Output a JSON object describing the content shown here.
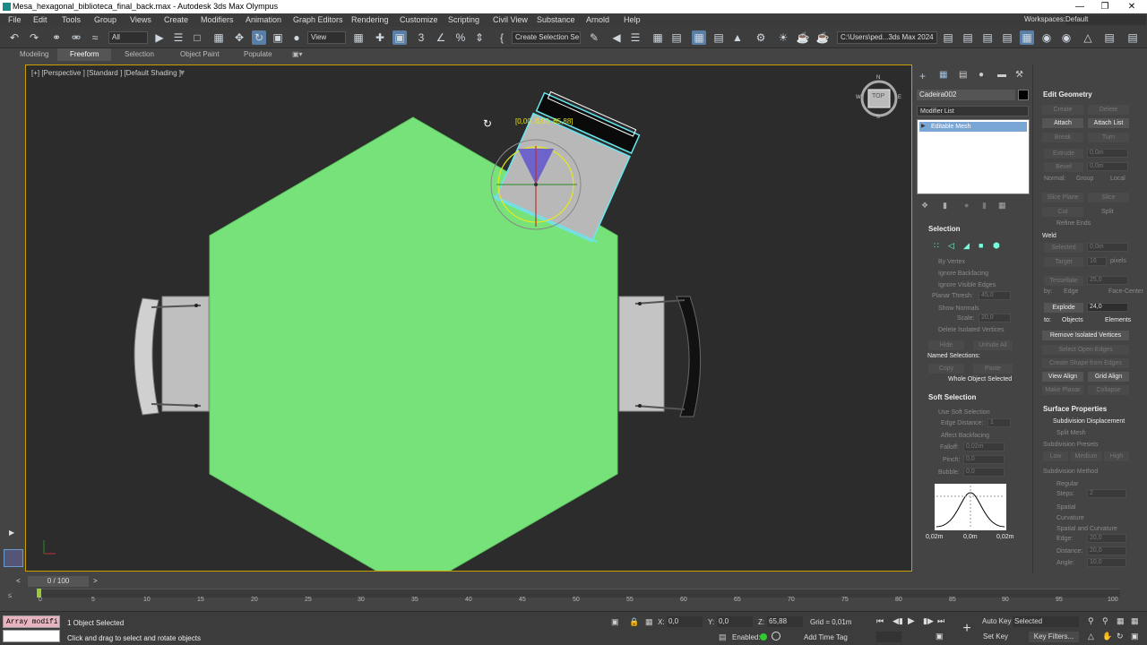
{
  "window": {
    "title": "Mesa_hexagonal_biblioteca_final_back.max - Autodesk 3ds Max Olympus"
  },
  "menu": [
    "File",
    "Edit",
    "Tools",
    "Group",
    "Views",
    "Create",
    "Modifiers",
    "Animation",
    "Graph Editors",
    "Rendering",
    "Customize",
    "Scripting",
    "Civil View",
    "Substance",
    "Arnold",
    "Help"
  ],
  "workspace": {
    "label": "Workspaces:",
    "value": "Default"
  },
  "toolbar": {
    "filter": "All",
    "coord": "View",
    "selset": "Create Selection Se",
    "path": "C:\\Users\\ped...3ds Max 2024"
  },
  "ribbon": {
    "tabs": [
      "Modeling",
      "Freeform",
      "Selection",
      "Object Paint",
      "Populate"
    ],
    "active": "Freeform"
  },
  "viewport": {
    "label": "[+] [Perspective ] [Standard ] [Default Shading ]",
    "gizmo_readout": "[0,00, 0,00, 65,88]",
    "viewcube": "TOP",
    "compass": {
      "n": "N",
      "s": "S",
      "e": "E",
      "w": "W"
    },
    "colors": {
      "table": "#77e27a",
      "selection": "#66e8f0",
      "bg": "#2c2c2c"
    }
  },
  "modify": {
    "object_name": "Cadeira002",
    "modifier_list": "Modifier List",
    "stack_item": "Editable Mesh"
  },
  "selection_rollout": {
    "title": "Selection",
    "by_vertex": "By Vertex",
    "ignore_backfacing": "Ignore Backfacing",
    "ignore_visible_edges": "Ignore Visible Edges",
    "planar_thresh": "Planar Thresh:",
    "planar_val": "45,0",
    "show_normals": "Show Normals",
    "scale": "Scale:",
    "scale_val": "20,0",
    "delete_isolated": "Delete Isolated Vertices",
    "hide": "Hide",
    "unhide_all": "Unhide All",
    "named_selections": "Named Selections:",
    "copy": "Copy",
    "paste": "Paste",
    "status": "Whole Object Selected"
  },
  "soft_selection": {
    "title": "Soft Selection",
    "use_soft": "Use Soft Selection",
    "edge_distance": "Edge Distance:",
    "edge_val": "1",
    "affect_backfacing": "Affect Backfacing",
    "falloff": "Falloff:",
    "falloff_val": "0,02m",
    "pinch": "Pinch:",
    "pinch_val": "0,0",
    "bubble": "Bubble:",
    "bubble_val": "0,0",
    "curve_labels": [
      "0,02m",
      "0,0m",
      "0,02m"
    ]
  },
  "edit_geometry": {
    "title": "Edit Geometry",
    "create": "Create",
    "delete": "Delete",
    "attach": "Attach",
    "attach_list": "Attach List",
    "break": "Break",
    "turn": "Turn",
    "extrude": "Extrude",
    "extrude_val": "0,0m",
    "bevel": "Bevel",
    "bevel_val": "0,0m",
    "normal": "Normal:",
    "group": "Group",
    "local": "Local",
    "slice_plane": "Slice Plane",
    "slice": "Slice",
    "cut": "Cut",
    "split": "Split",
    "refine_ends": "Refine Ends",
    "weld": "Weld",
    "selected": "Selected",
    "selected_val": "0,0m",
    "target": "Target",
    "target_val": "16",
    "pixels": "pixels",
    "tessellate": "Tessellate",
    "tess_val": "25,0",
    "by": "by:",
    "edge": "Edge",
    "face_center": "Face-Center",
    "explode": "Explode",
    "explode_val": "24,0",
    "to": "to:",
    "objects": "Objects",
    "elements": "Elements",
    "remove_isolated": "Remove Isolated Vertices",
    "select_open_edges": "Select Open Edges",
    "create_shape": "Create Shape from Edges",
    "view_align": "View Align",
    "grid_align": "Grid Align",
    "make_planar": "Make Planar",
    "collapse": "Collapse"
  },
  "surface": {
    "title": "Surface Properties",
    "subdiv_disp": "Subdivision Displacement",
    "split_mesh": "Split Mesh",
    "presets": "Subdivision Presets",
    "low": "Low",
    "medium": "Medium",
    "high": "High",
    "method": "Subdivision Method",
    "regular": "Regular",
    "steps": "Steps:",
    "steps_val": "2",
    "spatial": "Spatial",
    "curvature": "Curvature",
    "spatial_curv": "Spatial and Curvature",
    "edge": "Edge:",
    "edge_val": "20,0",
    "distance": "Distance:",
    "distance_val": "20,0",
    "angle": "Angle:",
    "angle_val": "10,0"
  },
  "timeline": {
    "frame": "0 / 100",
    "ticks": [
      "0",
      "5",
      "10",
      "15",
      "20",
      "25",
      "30",
      "35",
      "40",
      "45",
      "50",
      "55",
      "60",
      "65",
      "70",
      "75",
      "80",
      "85",
      "90",
      "95",
      "100"
    ]
  },
  "status": {
    "script": "Array modifi",
    "selected": "1 Object Selected",
    "prompt": "Click and drag to select and rotate objects",
    "x_label": "X:",
    "x": "0,0",
    "y_label": "Y:",
    "y": "0,0",
    "z_label": "Z:",
    "z": "65,88",
    "grid": "Grid = 0,01m",
    "enabled": "Enabled:",
    "add_time_tag": "Add Time Tag",
    "auto_key": "Auto Key",
    "selected_dd": "Selected",
    "set_key": "Set Key",
    "key_filters": "Key Filters..."
  }
}
